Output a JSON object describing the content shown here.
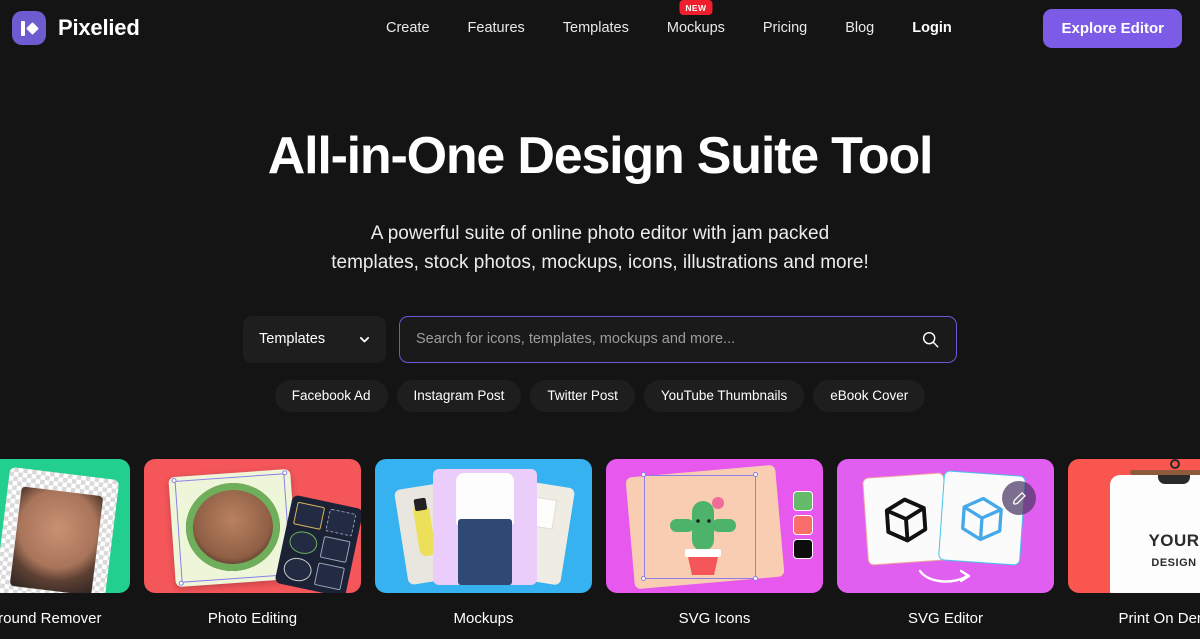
{
  "brand": {
    "name": "Pixelied",
    "logo_icon": "pixelied-logo-icon",
    "accent": "#6d5bd0"
  },
  "nav": {
    "items": [
      {
        "label": "Create",
        "badge": null
      },
      {
        "label": "Features",
        "badge": null
      },
      {
        "label": "Templates",
        "badge": null
      },
      {
        "label": "Mockups",
        "badge": "NEW"
      },
      {
        "label": "Pricing",
        "badge": null
      },
      {
        "label": "Blog",
        "badge": null
      },
      {
        "label": "Login",
        "badge": null
      }
    ],
    "cta_label": "Explore Editor",
    "cta_color": "#7c5ce6",
    "badge_color": "#f01f2e"
  },
  "hero": {
    "title": "All-in-One Design Suite Tool",
    "subtitle_line1": "A powerful suite of online photo editor with jam packed",
    "subtitle_line2": "templates, stock photos, mockups, icons, illustrations and more!"
  },
  "search": {
    "category_selected": "Templates",
    "category_icon": "chevron-down-icon",
    "placeholder": "Search for icons, templates, mockups and more...",
    "value": "",
    "submit_icon": "search-icon",
    "border_color": "#6f55d8"
  },
  "chips": [
    {
      "label": "Facebook Ad"
    },
    {
      "label": "Instagram Post"
    },
    {
      "label": "Twitter Post"
    },
    {
      "label": "YouTube Thumbnails"
    },
    {
      "label": "eBook Cover"
    }
  ],
  "carousel": {
    "cards": [
      {
        "label": "Background Remover",
        "color": "#23cf8e",
        "truncated_left": true
      },
      {
        "label": "Photo Editing",
        "color": "#f4565a"
      },
      {
        "label": "Mockups",
        "color": "#37b2f0"
      },
      {
        "label": "SVG Icons",
        "color": "#e758ef"
      },
      {
        "label": "SVG Editor",
        "color": "#e05ef0"
      },
      {
        "label": "Print On Demand",
        "color": "#f9564f",
        "truncated_right": true
      }
    ],
    "swatch_colors": [
      "#66bb6a",
      "#fb6c6c",
      "#0d0d0d"
    ],
    "edit_badge_icon": "pencil-icon"
  },
  "page": {
    "background": "#141414"
  }
}
